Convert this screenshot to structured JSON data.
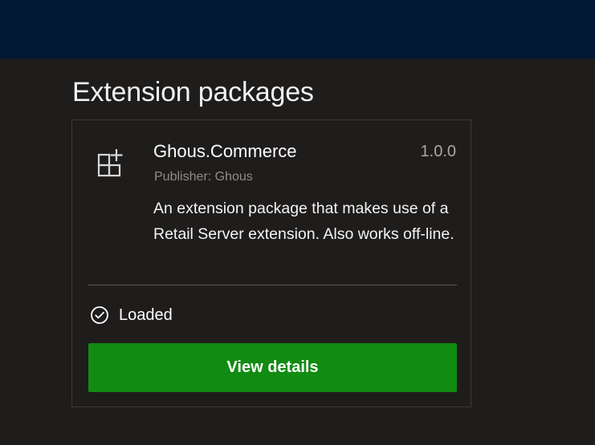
{
  "page": {
    "title": "Extension packages"
  },
  "package": {
    "name": "Ghous.Commerce",
    "version": "1.0.0",
    "publisher": "Publisher: Ghous",
    "description": "An extension package that makes use of a Retail Server extension. Also works off-line.",
    "icon": "package-grid-icon",
    "status": {
      "label": "Loaded",
      "icon": "checkmark-circle-icon"
    },
    "action": {
      "label": "View details"
    }
  },
  "colors": {
    "background": "#1f1d1c",
    "banner": "#001834",
    "button": "#128b12",
    "card_border": "#3c3a38"
  }
}
